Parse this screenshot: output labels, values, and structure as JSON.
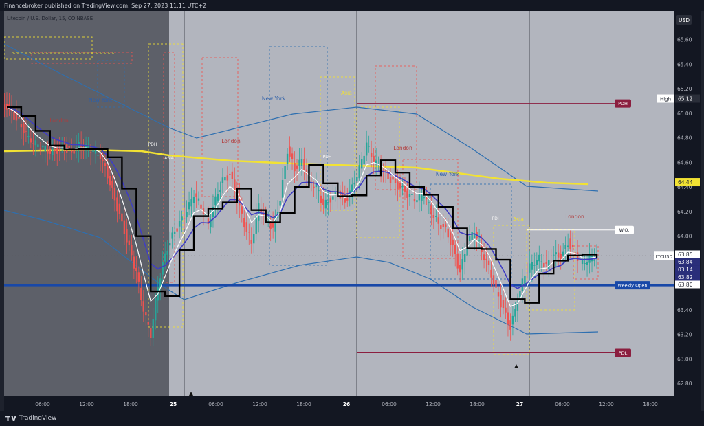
{
  "header": {
    "published_text": "Financebroker published on TradingView.com, Sep 27, 2023 11:11 UTC+2"
  },
  "footer": {
    "brand": "TradingView"
  },
  "colors": {
    "background": "#b2b5be",
    "dark_region": "#5d6069",
    "axis_bg": "#131722",
    "candle_up": "#26a69a",
    "candle_down": "#ef5350",
    "ema_slow": "#f2e233",
    "ema_fast": "#3f3dc4",
    "band": "#2e6fb0",
    "weekly_open": "#1848a8",
    "session_black": "#000000",
    "session_white": "#ffffff",
    "pdh_pdl": "#8b1e3f"
  },
  "chart_data": {
    "type": "candlestick",
    "symbol": "LTCUSD",
    "subtitle": "Litecoin / U.S. Dollar, 15, COINBASE",
    "currency": "USD",
    "y_ticks": [
      65.6,
      65.4,
      65.2,
      65.0,
      64.8,
      64.6,
      64.4,
      64.2,
      64.0,
      63.8,
      63.6,
      63.4,
      63.2,
      63.0,
      62.8
    ],
    "y_range": [
      62.7,
      65.8
    ],
    "x_tick_labels": [
      "06:00",
      "12:00",
      "18:00",
      "25",
      "06:00",
      "12:00",
      "18:00",
      "26",
      "06:00",
      "12:00",
      "18:00",
      "27",
      "06:00",
      "12:00",
      "18:00"
    ],
    "day_separators": [
      "25",
      "26",
      "27"
    ],
    "high_label": {
      "text": "High",
      "value": "65.12"
    },
    "price_labels": {
      "ema_value": "64.44",
      "last_high": "63.85",
      "last": "63.84",
      "countdown": "03:14",
      "last_low": "63.82",
      "tick_value": "63.80"
    },
    "levels": {
      "pdh": {
        "text": "PDH",
        "value": 65.08
      },
      "pdl": {
        "text": "PDL",
        "value": 63.05
      },
      "weekly_open": {
        "text": "Weekly Open",
        "value": 63.6
      },
      "wo_label": {
        "text": "W.O.",
        "value": 64.05
      }
    },
    "sessions": [
      {
        "name": "New York",
        "day": 0,
        "value": 65.1
      },
      {
        "name": "London",
        "day": 0,
        "value": 64.88
      },
      {
        "name": "London",
        "day": 1,
        "value": 64.75
      },
      {
        "name": "New York",
        "day": 1,
        "value": 65.12
      },
      {
        "name": "Asia",
        "day": 1,
        "value": 65.22
      },
      {
        "name": "London",
        "day": 2,
        "value": 64.7
      },
      {
        "name": "New York",
        "day": 2,
        "value": 64.46
      },
      {
        "name": "Asia",
        "day": 2,
        "value": 64.18
      },
      {
        "name": "London",
        "day": 3,
        "value": 64.02
      }
    ],
    "small_labels": [
      "PDH",
      "ASIA",
      "PDH",
      "PDH"
    ],
    "close_path": [
      65.05,
      64.98,
      64.9,
      64.8,
      64.75,
      64.72,
      64.68,
      64.7,
      64.72,
      64.68,
      64.74,
      64.72,
      64.7,
      64.65,
      64.5,
      64.3,
      64.1,
      63.9,
      63.7,
      63.4,
      63.2,
      63.6,
      63.85,
      64.0,
      64.1,
      64.2,
      64.35,
      64.25,
      64.1,
      64.3,
      64.45,
      64.5,
      64.3,
      64.1,
      63.95,
      64.25,
      64.15,
      64.05,
      64.3,
      64.7,
      64.55,
      64.62,
      64.45,
      64.4,
      64.25,
      64.3,
      64.35,
      64.28,
      64.4,
      64.55,
      64.75,
      64.62,
      64.55,
      64.48,
      64.42,
      64.38,
      64.32,
      64.3,
      64.35,
      64.2,
      64.1,
      64.05,
      63.9,
      63.7,
      63.95,
      64.05,
      63.88,
      63.75,
      63.55,
      63.4,
      63.25,
      63.48,
      63.7,
      63.78,
      63.82,
      63.75,
      63.85,
      63.82,
      63.95,
      63.85,
      63.78,
      63.82,
      63.84
    ]
  }
}
